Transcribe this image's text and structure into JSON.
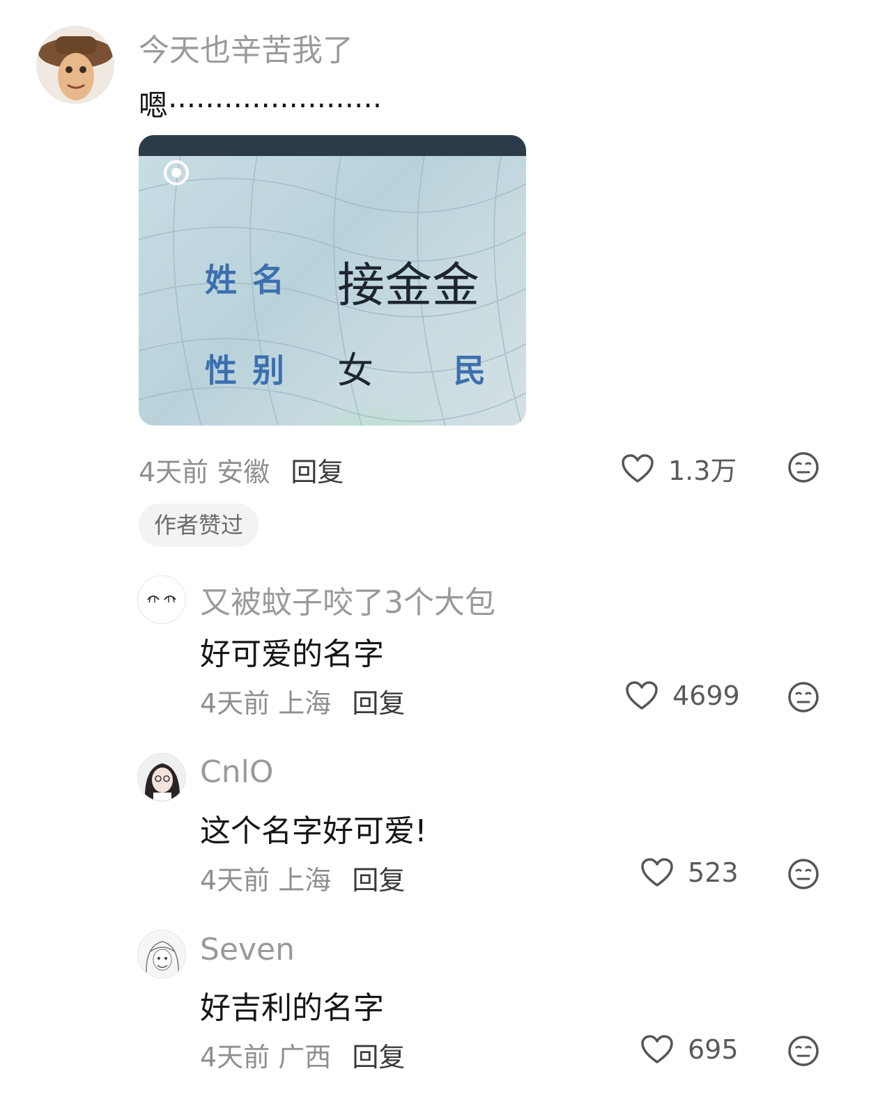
{
  "comments": [
    {
      "username": "今天也辛苦我了",
      "text": "嗯·······················",
      "time": "4天前",
      "location": "安徽",
      "reply_label": "回复",
      "likes": "1.3万",
      "badge": "作者赞过",
      "avatar_icon": "cowboy-avatar",
      "image": {
        "name_label": "姓名",
        "name_value": "接金金",
        "gender_label": "性别",
        "gender_value": "女",
        "ethnic_label": "民 族"
      }
    },
    {
      "username": "又被蚊子咬了3个大包",
      "text": "好可爱的名字",
      "time": "4天前",
      "location": "上海",
      "reply_label": "回复",
      "likes": "4699",
      "avatar_icon": "sketch-eyes-avatar"
    },
    {
      "username": "CnlO",
      "text": "这个名字好可爱!",
      "time": "4天前",
      "location": "上海",
      "reply_label": "回复",
      "likes": "523",
      "avatar_icon": "anime-girl-avatar"
    },
    {
      "username": "Seven",
      "text": "好吉利的名字",
      "time": "4天前",
      "location": "广西",
      "reply_label": "回复",
      "likes": "695",
      "avatar_icon": "sketch-girl-avatar"
    }
  ],
  "icons": {
    "like": "heart-outline-icon",
    "react": "neutral-face-icon"
  },
  "colors": {
    "username": "#9a9a9a",
    "meta": "#8f8f8f",
    "text": "#161616",
    "badge_bg": "#f3f3f3"
  }
}
